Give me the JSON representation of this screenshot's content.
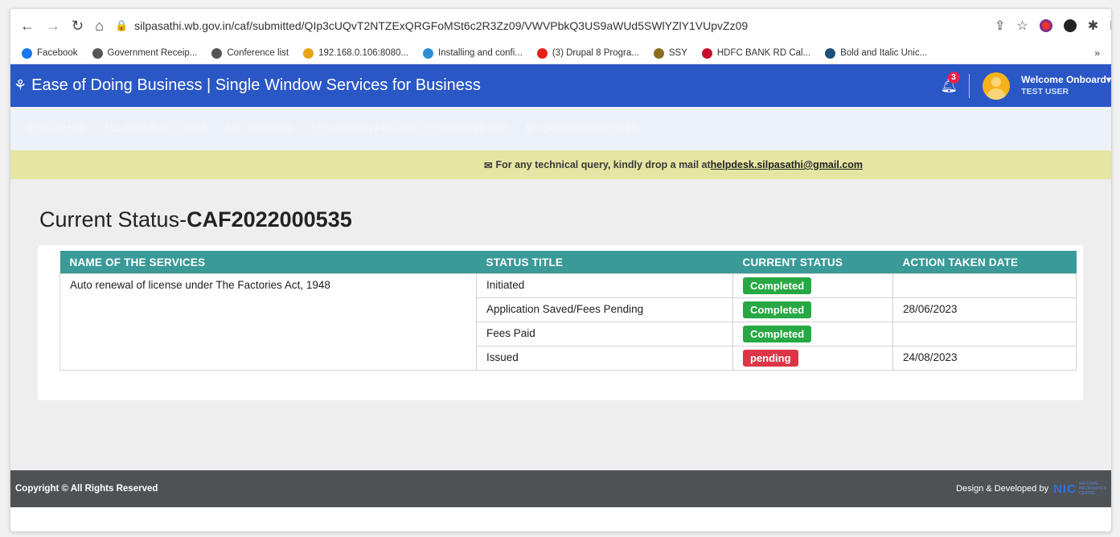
{
  "browser": {
    "url": "silpasathi.wb.gov.in/caf/submitted/QIp3cUQvT2NTZExQRGFoMSt6c2R3Zz09/VWVPbkQ3US9aWUd5SWlYZlY1VUpvZz09",
    "bookmarks": [
      {
        "label": "Facebook",
        "color": "#1877f2"
      },
      {
        "label": "Government Receip...",
        "color": "#555555"
      },
      {
        "label": "Conference list",
        "color": "#555555"
      },
      {
        "label": "192.168.0.106:8080...",
        "color": "#e8a317"
      },
      {
        "label": "Installing and confi...",
        "color": "#2c8fd6"
      },
      {
        "label": "(3) Drupal 8 Progra...",
        "color": "#e62117"
      },
      {
        "label": "SSY",
        "color": "#8a6d1f"
      },
      {
        "label": "HDFC BANK RD Cal...",
        "color": "#c8102e"
      },
      {
        "label": "Bold and Italic Unic...",
        "color": "#1f4e79"
      }
    ],
    "more": "»"
  },
  "header": {
    "title": "Ease of Doing Business | Single Window Services for Business",
    "notification_count": "3",
    "welcome": "Welcome Onboard",
    "user": "TEST USER"
  },
  "menu": [
    "DASHBOARD",
    "ALL ESTABLISHMENTS",
    "ALL SERVICES",
    "APPLICATION FORM/COMPREHENSIVE LIST",
    "MY QUERY/GRIEVANCES"
  ],
  "notice": {
    "text": "For any technical query, kindly drop a mail at ",
    "email": "helpdesk.silpasathi@gmail.com"
  },
  "page": {
    "title_prefix": "Current Status-",
    "caf_id": "CAF2022000535"
  },
  "table": {
    "headers": [
      "NAME OF THE SERVICES",
      "STATUS TITLE",
      "CURRENT STATUS",
      "ACTION TAKEN DATE"
    ],
    "service_name": "Auto renewal of license under The Factories Act, 1948",
    "rows": [
      {
        "title": "Initiated",
        "status": "Completed",
        "date": ""
      },
      {
        "title": "Application Saved/Fees Pending",
        "status": "Completed",
        "date": "28/06/2023"
      },
      {
        "title": "Fees Paid",
        "status": "Completed",
        "date": ""
      },
      {
        "title": "Issued",
        "status": "pending",
        "date": "24/08/2023"
      }
    ]
  },
  "footer": {
    "copyright": "Copyright © All Rights Reserved",
    "developed": "Design & Developed by",
    "nic": "NIC",
    "nic_sub1": "NATIONAL",
    "nic_sub2": "INFORMATICS",
    "nic_sub3": "CENTRE"
  }
}
